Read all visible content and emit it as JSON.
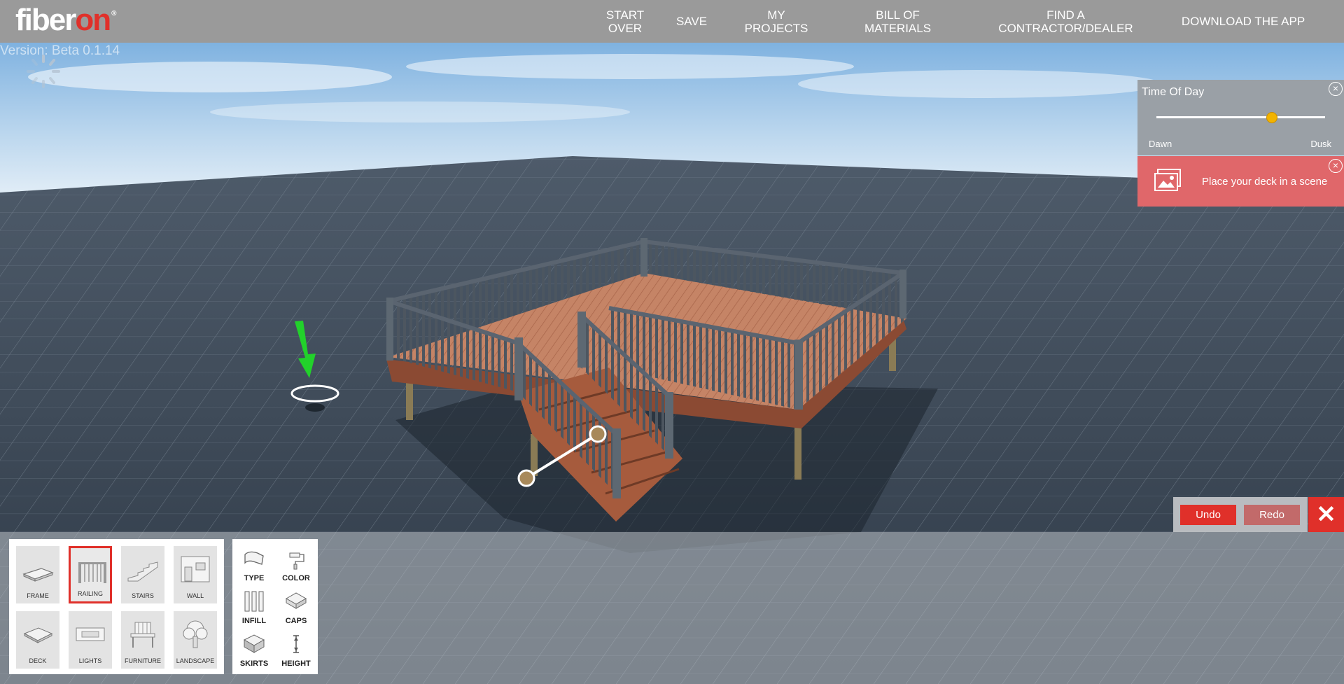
{
  "brand": {
    "logo_text_a": "fiber",
    "logo_text_b": "on",
    "logo_mark": "®"
  },
  "nav": [
    {
      "label": "START\nOVER"
    },
    {
      "label": "SAVE"
    },
    {
      "label": "MY\nPROJECTS"
    },
    {
      "label": "BILL OF\nMATERIALS"
    },
    {
      "label": "FIND A\nCONTRACTOR/DEALER"
    },
    {
      "label": "DOWNLOAD THE APP"
    }
  ],
  "version": "Version: Beta 0.1.14",
  "time_of_day": {
    "title": "Time Of Day",
    "left_label": "Dawn",
    "right_label": "Dusk",
    "value": 0.68
  },
  "scene_prompt": {
    "label": "Place your deck in a scene",
    "icon": "image-gallery-icon"
  },
  "actions": {
    "undo": "Undo",
    "redo": "Redo",
    "close": "✕"
  },
  "categories": [
    {
      "label": "FRAME",
      "icon": "frame-icon",
      "selected": false
    },
    {
      "label": "RAILING",
      "icon": "railing-icon",
      "selected": true
    },
    {
      "label": "STAIRS",
      "icon": "stairs-icon",
      "selected": false
    },
    {
      "label": "WALL",
      "icon": "wall-icon",
      "selected": false
    },
    {
      "label": "DECK",
      "icon": "deck-icon",
      "selected": false
    },
    {
      "label": "LIGHTS",
      "icon": "lights-icon",
      "selected": false
    },
    {
      "label": "FURNITURE",
      "icon": "furniture-icon",
      "selected": false
    },
    {
      "label": "LANDSCAPE",
      "icon": "landscape-icon",
      "selected": false
    }
  ],
  "railing_options": [
    {
      "label": "TYPE",
      "icon": "type-icon"
    },
    {
      "label": "COLOR",
      "icon": "color-icon"
    },
    {
      "label": "INFILL",
      "icon": "infill-icon"
    },
    {
      "label": "CAPS",
      "icon": "caps-icon"
    },
    {
      "label": "SKIRTS",
      "icon": "skirts-icon"
    },
    {
      "label": "HEIGHT",
      "icon": "height-icon"
    }
  ],
  "colors": {
    "accent": "#e0302a",
    "topbar": "#9a9a9a",
    "scene_panel": "#e0676a",
    "slider_thumb": "#f2b300"
  }
}
